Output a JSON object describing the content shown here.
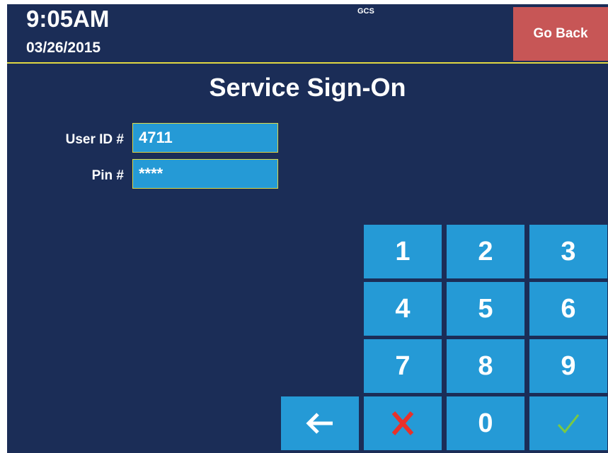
{
  "header": {
    "time": "9:05AM",
    "date": "03/26/2015",
    "system": "GCS",
    "go_back_label": "Go Back"
  },
  "page": {
    "title": "Service Sign-On"
  },
  "form": {
    "user_id_label": "User ID #",
    "user_id_value": "4711",
    "pin_label": "Pin #",
    "pin_value": "****"
  },
  "keypad": {
    "keys": [
      "1",
      "2",
      "3",
      "4",
      "5",
      "6",
      "7",
      "8",
      "9",
      "0"
    ],
    "backspace_icon": "left-arrow-icon",
    "clear_icon": "red-x-icon",
    "enter_icon": "green-checkmark-icon"
  },
  "colors": {
    "background": "#1b2d57",
    "keypad_blue": "#259ad6",
    "go_back_red": "#c75656",
    "accent_yellow": "#e0d842",
    "clear_red": "#e8312a",
    "confirm_green": "#7ac943"
  }
}
